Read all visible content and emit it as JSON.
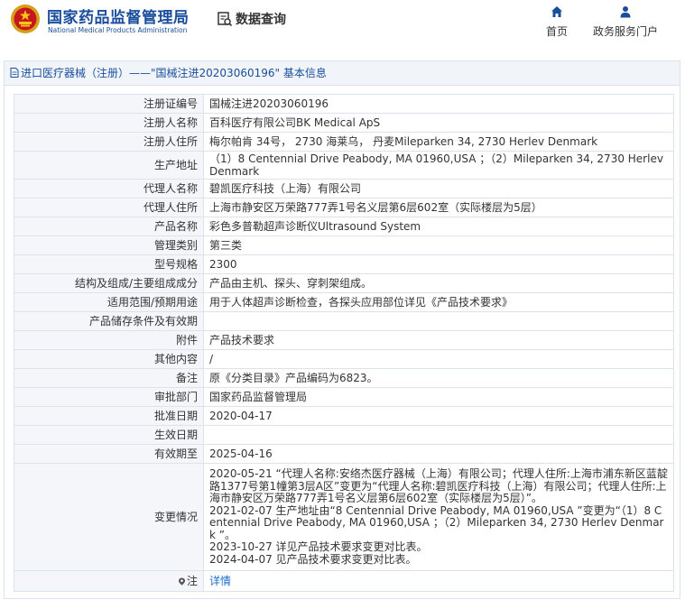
{
  "site": {
    "name_cn": "国家药品监督管理局",
    "name_en": "National Medical Products Administration",
    "db_query": "数据查询",
    "brand_color": "#1a4e9c"
  },
  "nav": [
    {
      "label": "首页",
      "icon": "home-icon"
    },
    {
      "label": "政务服务门户",
      "icon": "user-icon"
    }
  ],
  "panel": {
    "title": "进口医疗器械（注册）——\"国械注进20203060196\" 基本信息"
  },
  "rows": [
    {
      "label": "注册证编号",
      "value": "国械注进20203060196"
    },
    {
      "label": "注册人名称",
      "value": "百科医疗有限公司BK Medical ApS"
    },
    {
      "label": "注册人住所",
      "value": "梅尔帕肯 34号， 2730 海莱乌， 丹麦Mileparken 34, 2730 Herlev Denmark"
    },
    {
      "label": "生产地址",
      "value": "（1）8 Centennial Drive Peabody, MA 01960,USA ；（2）Mileparken 34, 2730 Herlev Denmark"
    },
    {
      "label": "代理人名称",
      "value": "碧凯医疗科技（上海）有限公司"
    },
    {
      "label": "代理人住所",
      "value": "上海市静安区万荣路777弄1号名义层第6层602室（实际楼层为5层）"
    },
    {
      "label": "产品名称",
      "value": "彩色多普勒超声诊断仪Ultrasound System"
    },
    {
      "label": "管理类别",
      "value": "第三类"
    },
    {
      "label": "型号规格",
      "value": "2300"
    },
    {
      "label": "结构及组成/主要组成成分",
      "value": "产品由主机、探头、穿刺架组成。"
    },
    {
      "label": "适用范围/预期用途",
      "value": "用于人体超声诊断检查，各探头应用部位详见《产品技术要求》"
    },
    {
      "label": "产品储存条件及有效期",
      "value": ""
    },
    {
      "label": "附件",
      "value": "产品技术要求"
    },
    {
      "label": "其他内容",
      "value": "/"
    },
    {
      "label": "备注",
      "value": "原《分类目录》产品编码为6823。"
    },
    {
      "label": "审批部门",
      "value": "国家药品监督管理局"
    },
    {
      "label": "批准日期",
      "value": "2020-04-17"
    },
    {
      "label": "生效日期",
      "value": ""
    },
    {
      "label": "有效期至",
      "value": "2025-04-16"
    }
  ],
  "changes": {
    "label": "变更情况",
    "lines": [
      "2020-05-21 “代理人名称:安络杰医疗器械（上海）有限公司；代理人住所:上海市浦东新区蓝靛路1377号第1幢第3层A区”变更为“代理人名称:碧凯医疗科技（上海）有限公司；代理人住所:上海市静安区万荣路777弄1号名义层第6层602室（实际楼层为5层）”。",
      "2021-02-07 生产地址由“8 Centennial Drive Peabody, MA 01960,USA ”变更为“（1）8 Centennial Drive Peabody, MA 01960,USA ；（2）Mileparken 34, 2730 Herlev Denmark ”。",
      "2023-10-27 详见产品技术要求变更对比表。",
      "2024-04-07 见产品技术要求变更对比表。"
    ]
  },
  "annotation": {
    "label": "注",
    "link": "详情"
  }
}
